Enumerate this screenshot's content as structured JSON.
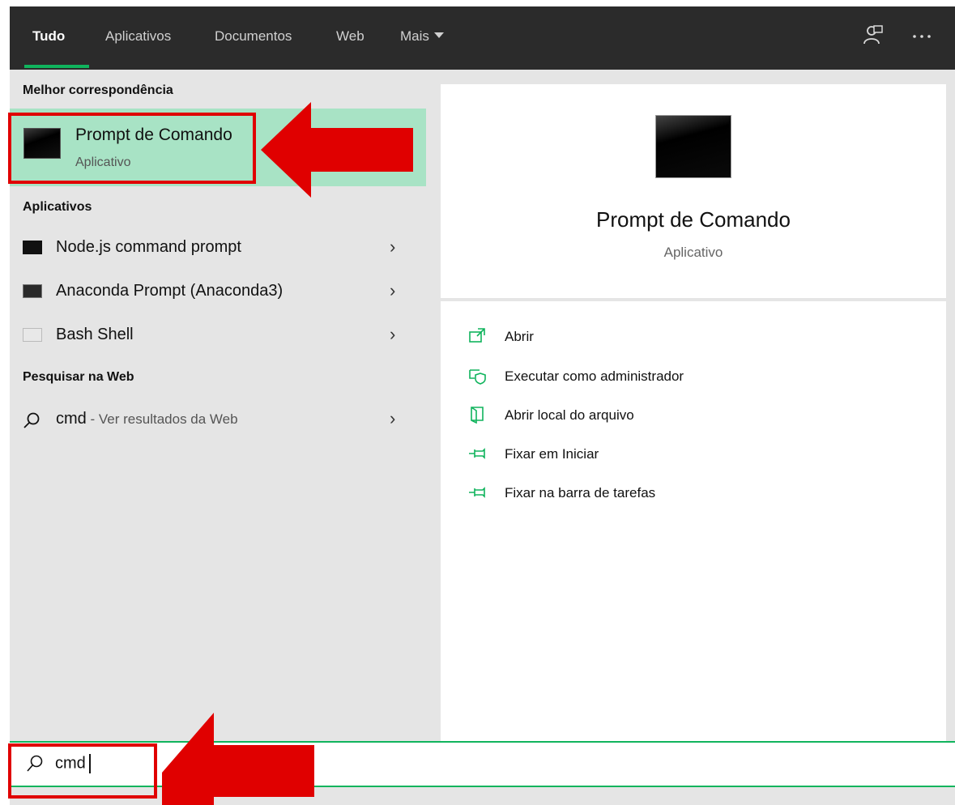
{
  "tabs": [
    {
      "label": "Tudo"
    },
    {
      "label": "Aplicativos"
    },
    {
      "label": "Documentos"
    },
    {
      "label": "Web"
    },
    {
      "label": "Mais"
    }
  ],
  "left": {
    "best_match_label": "Melhor correspondência",
    "best_match": {
      "title": "Prompt de Comando",
      "subtitle": "Aplicativo"
    },
    "apps_label": "Aplicativos",
    "apps": [
      {
        "label": "Node.js command prompt"
      },
      {
        "label": "Anaconda Prompt (Anaconda3)"
      },
      {
        "label": "Bash Shell"
      }
    ],
    "web_label": "Pesquisar na Web",
    "web_result": {
      "query": "cmd",
      "suffix": " - Ver resultados da Web"
    }
  },
  "preview": {
    "title": "Prompt de Comando",
    "subtitle": "Aplicativo",
    "actions": [
      {
        "label": "Abrir",
        "icon": "open-icon"
      },
      {
        "label": "Executar como administrador",
        "icon": "shield-icon"
      },
      {
        "label": "Abrir local do arquivo",
        "icon": "file-location-icon"
      },
      {
        "label": "Fixar em Iniciar",
        "icon": "pin-icon"
      },
      {
        "label": "Fixar na barra de tarefas",
        "icon": "pin-icon"
      }
    ]
  },
  "search": {
    "value": "cmd"
  },
  "colors": {
    "accent": "#10b45d",
    "highlight": "#a8e3c5",
    "annotation": "#e00000",
    "topbar": "#2b2b2b"
  }
}
